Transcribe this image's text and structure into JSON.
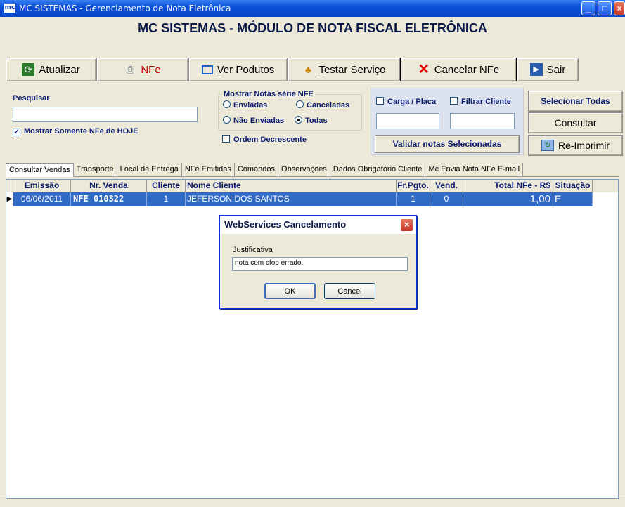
{
  "window": {
    "icon_text": "mc",
    "title": "MC SISTEMAS - Gerenciamento de Nota Eletrônica",
    "minimize": "_",
    "maximize": "□",
    "close": "×"
  },
  "app_title": "MC SISTEMAS - MÓDULO DE NOTA FISCAL ELETRÔNICA",
  "toolbar": {
    "atualizar": {
      "pre": "Atuali",
      "u": "z",
      "post": "ar"
    },
    "nfe": {
      "u": "N",
      "post": "Fe"
    },
    "ver_produtos": {
      "u": "V",
      "post": "er Podutos"
    },
    "testar_servico": {
      "u": "T",
      "post": "estar Serviço"
    },
    "cancelar_nfe": {
      "u": "C",
      "post": "ancelar NFe"
    },
    "sair": {
      "u": "S",
      "post": "air"
    }
  },
  "search": {
    "label": "Pesquisar",
    "value": "",
    "only_today_label": "Mostrar Somente NFe de HOJE",
    "only_today_checked": true
  },
  "filter_group": {
    "legend": "Mostrar Notas série NFE",
    "enviadas": "Enviadas",
    "canceladas": "Canceladas",
    "nao_enviadas": "Não Enviadas",
    "todas": "Todas",
    "selected": "Todas",
    "ordem_decrescente": "Ordem Decrescente"
  },
  "blue_panel": {
    "carga_placa": {
      "u": "C",
      "post": "arga / Placa"
    },
    "filtrar_cliente": {
      "u": "F",
      "post": "iltrar Cliente"
    },
    "carga_value": "",
    "cliente_value": "",
    "validar": "Validar notas Selecionadas"
  },
  "side_buttons": {
    "selecionar_todas": "Selecionar Todas",
    "consultar": "Consultar",
    "reimprimir": {
      "u": "R",
      "post": "e-Imprimir"
    }
  },
  "tabs": [
    "Consultar Vendas",
    "Transporte",
    "Local de Entrega",
    "NFe Emitidas",
    "Comandos",
    "Observações",
    "Dados Obrigatório Cliente",
    "Mc Envia Nota NFe E-mail"
  ],
  "grid": {
    "columns": [
      "Emissão",
      "Nr. Venda",
      "Cliente",
      "Nome Cliente",
      "Fr.Pgto.",
      "Vend.",
      "Total  NFe - R$",
      "Situação"
    ],
    "rows": [
      {
        "emissao": "06/06/2011",
        "nr_venda": "NFE  010322",
        "cliente": "1",
        "nome": "JEFERSON DOS SANTOS",
        "fr_pgto": "1",
        "vend": "0",
        "total": "1,00",
        "situacao": "E"
      }
    ]
  },
  "dialog": {
    "title": "WebServices Cancelamento",
    "label": "Justificativa",
    "value": "nota com cfop errado.",
    "ok": "OK",
    "cancel": "Cancel"
  },
  "colors": {
    "title_blue": "#0a4fd6",
    "selection": "#316ac5",
    "window_bg": "#ece9d8"
  }
}
